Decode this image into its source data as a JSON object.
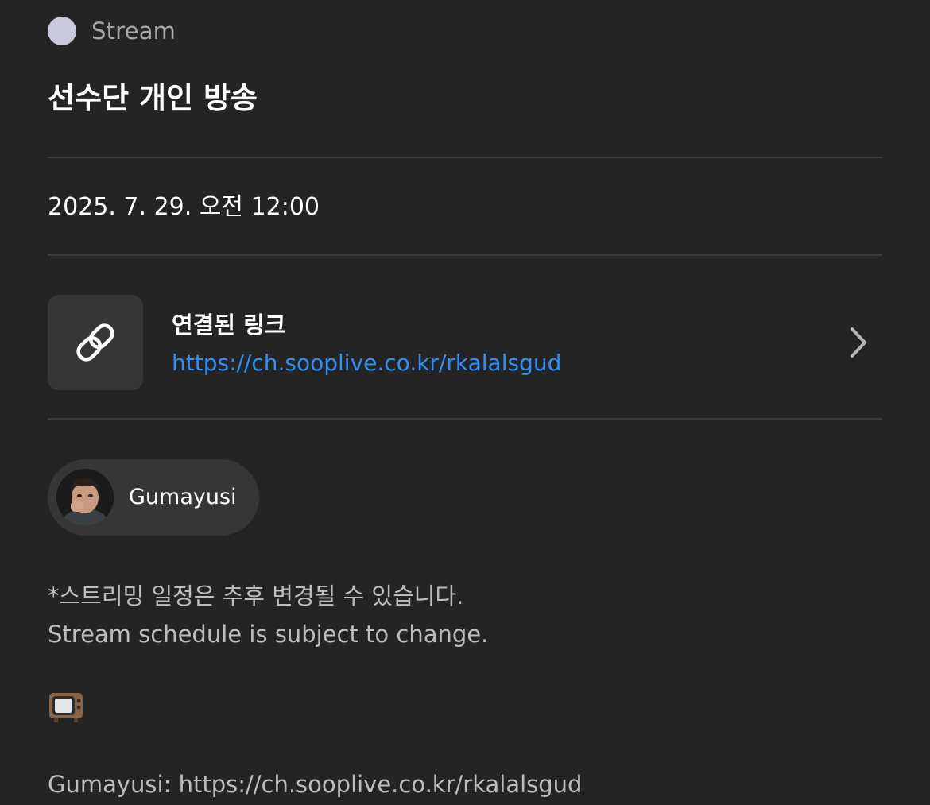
{
  "event": {
    "category_label": "Stream",
    "category_color": "#c8c9dc",
    "title": "선수단 개인 방송",
    "datetime": "2025. 7. 29. 오전 12:00"
  },
  "linked_link": {
    "heading": "연결된 링크",
    "url": "https://ch.sooplive.co.kr/rkalalsgud",
    "icon": "link-icon",
    "chevron_icon": "chevron-right-icon",
    "url_color": "#2f8ff5"
  },
  "participant": {
    "name": "Gumayusi",
    "avatar": "avatar-photo"
  },
  "description": {
    "notice_ko": "*스트리밍 일정은 추후 변경될 수 있습니다.",
    "notice_en": "Stream schedule is subject to change.",
    "emoji": "television-icon",
    "stream_link_line": "Gumayusi: https://ch.sooplive.co.kr/rkalalsgud"
  },
  "theme": {
    "background": "#242424",
    "card": "#363636",
    "divider": "#3a3a3a"
  }
}
